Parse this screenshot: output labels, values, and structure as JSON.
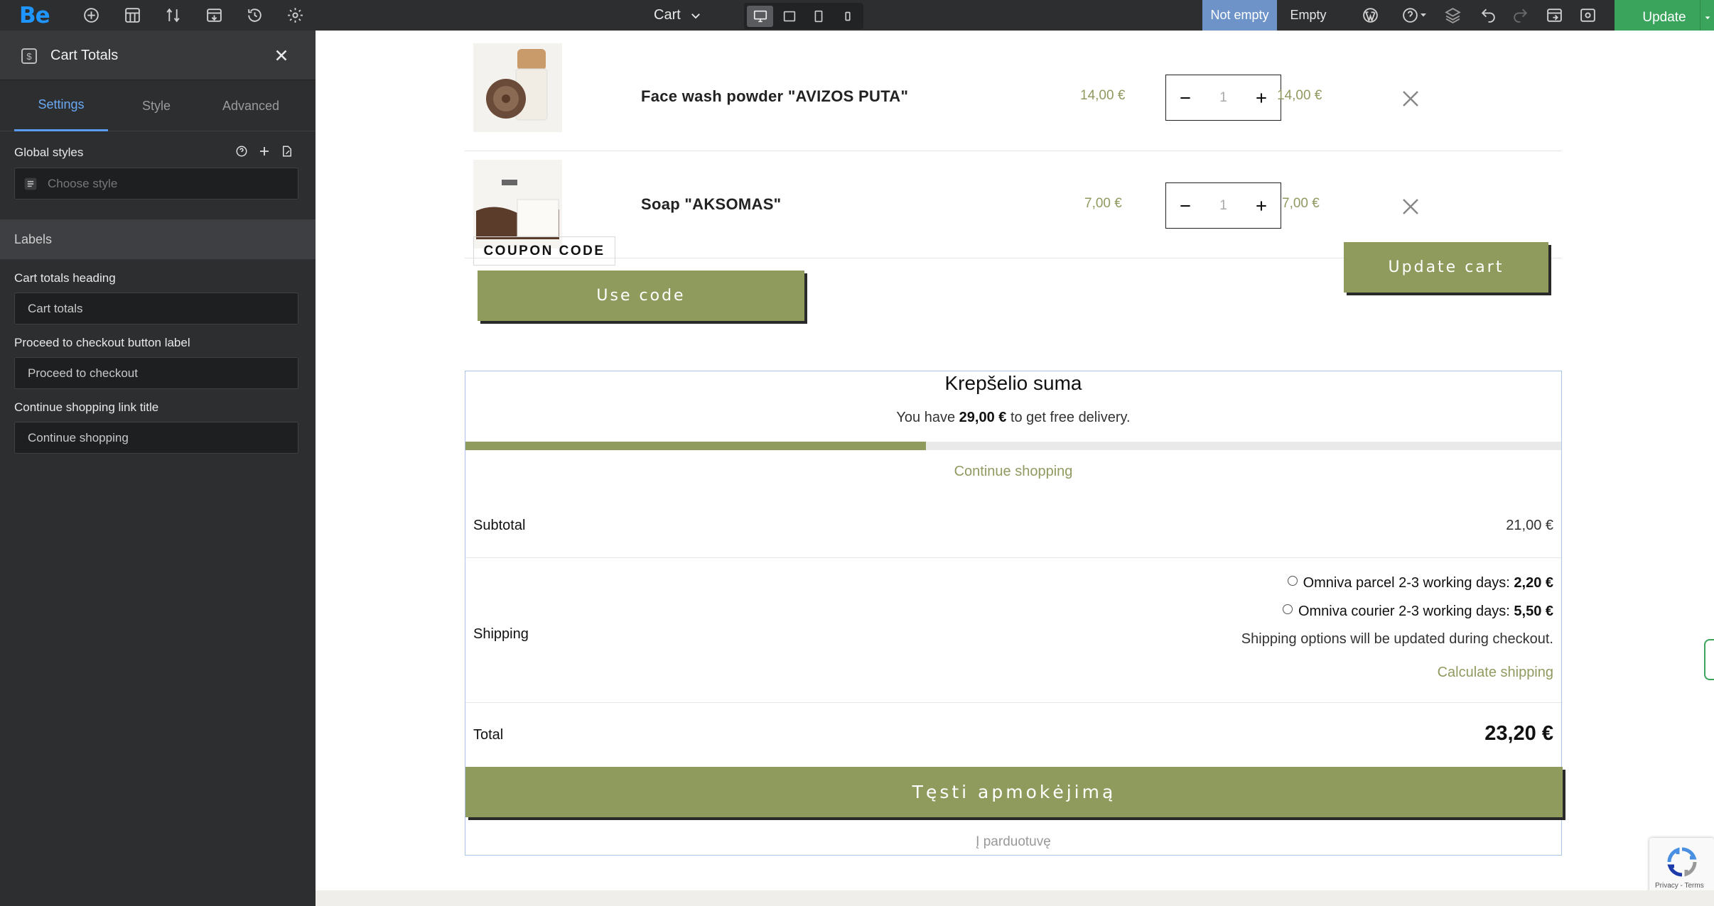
{
  "topbar": {
    "logo": "Be",
    "page_selector": "Cart",
    "state_not_empty": "Not empty",
    "state_empty": "Empty",
    "update_label": "Update",
    "accent_color": "#3aa45c"
  },
  "sidebar": {
    "panel_title": "Cart Totals",
    "tabs": [
      {
        "label": "Settings"
      },
      {
        "label": "Style"
      },
      {
        "label": "Advanced"
      }
    ],
    "global_styles_label": "Global styles",
    "global_styles_placeholder": "Choose style",
    "labels_section": "Labels",
    "fields": [
      {
        "label": "Cart totals heading",
        "value": "Cart totals"
      },
      {
        "label": "Proceed to checkout button label",
        "value": "Proceed to checkout"
      },
      {
        "label": "Continue shopping link title",
        "value": "Continue shopping"
      }
    ]
  },
  "cart": {
    "items": [
      {
        "name": "Face wash powder \"AVIZOS PUTA\"",
        "price": "14,00 €",
        "qty": "1",
        "subtotal": "14,00 €"
      },
      {
        "name": "Soap \"AKSOMAS\"",
        "price": "7,00 €",
        "qty": "1",
        "subtotal": "7,00 €"
      }
    ],
    "coupon_label": "COUPON CODE",
    "use_code_label": "Use code",
    "update_cart_label": "Update cart"
  },
  "totals": {
    "heading": "Krepšelio suma",
    "delivery_prefix": "You have ",
    "delivery_amount": "29,00 €",
    "delivery_suffix": " to get free delivery.",
    "progress_fraction": 0.42,
    "continue_shopping": "Continue shopping",
    "subtotal_label": "Subtotal",
    "subtotal_value": "21,00 €",
    "shipping_label": "Shipping",
    "shipping_options": [
      {
        "label": "Omniva parcel 2-3 working days: ",
        "price": "2,20 €"
      },
      {
        "label": "Omniva courier 2-3 working days: ",
        "price": "5,50 €"
      }
    ],
    "shipping_note": "Shipping options will be updated during checkout.",
    "calculate_shipping": "Calculate shipping",
    "total_label": "Total",
    "total_value": "23,20 €",
    "checkout_label": "Tęsti apmokėjimą",
    "shop_link": "Į parduotuvę",
    "olive_color": "#8f9a5d"
  },
  "recaptcha": {
    "terms": "Privacy - Terms"
  }
}
